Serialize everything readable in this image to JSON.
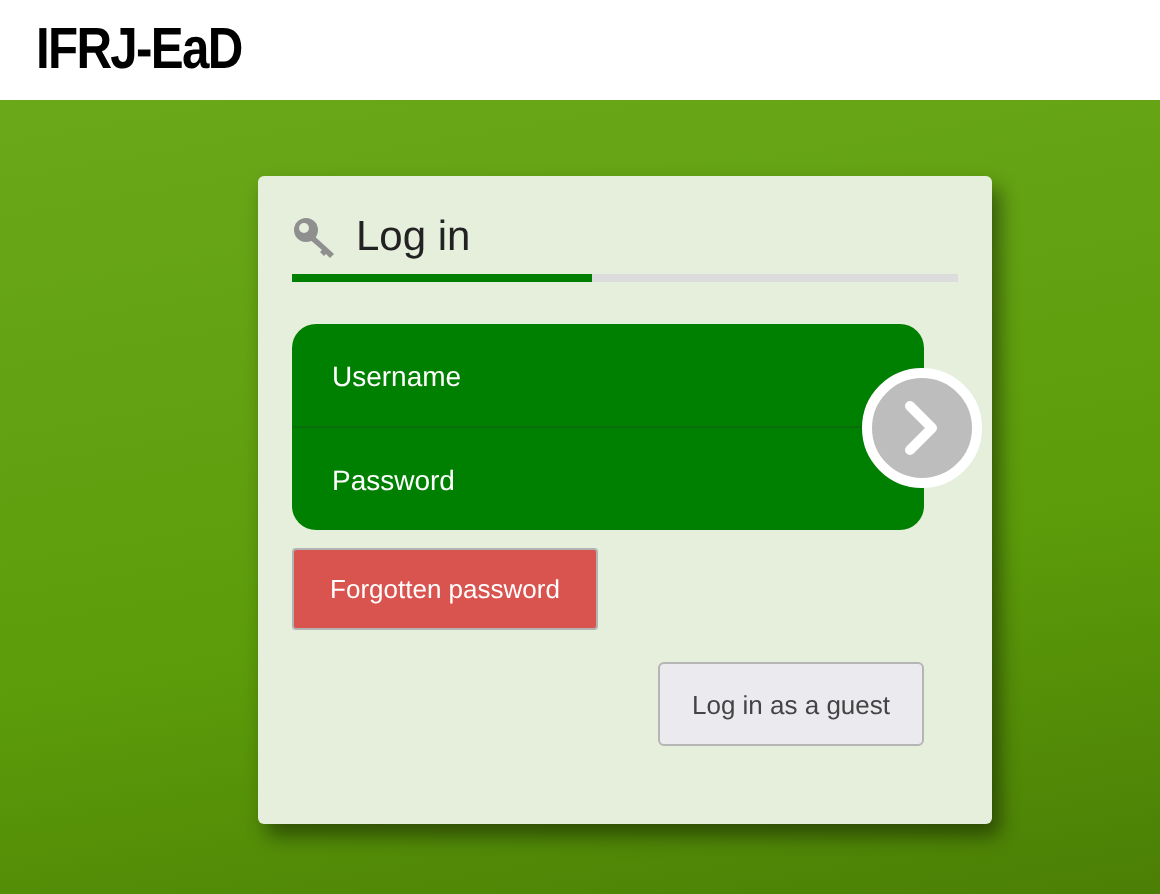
{
  "header": {
    "logo": "IFRJ-EaD"
  },
  "login": {
    "title": "Log in",
    "progress": {
      "level": 0.45
    },
    "fields": [
      {
        "placeholder": "Username"
      },
      {
        "placeholder": "Password"
      }
    ],
    "forgot_button": "Forgotten password",
    "guest_button": "Log in as a guest"
  }
}
